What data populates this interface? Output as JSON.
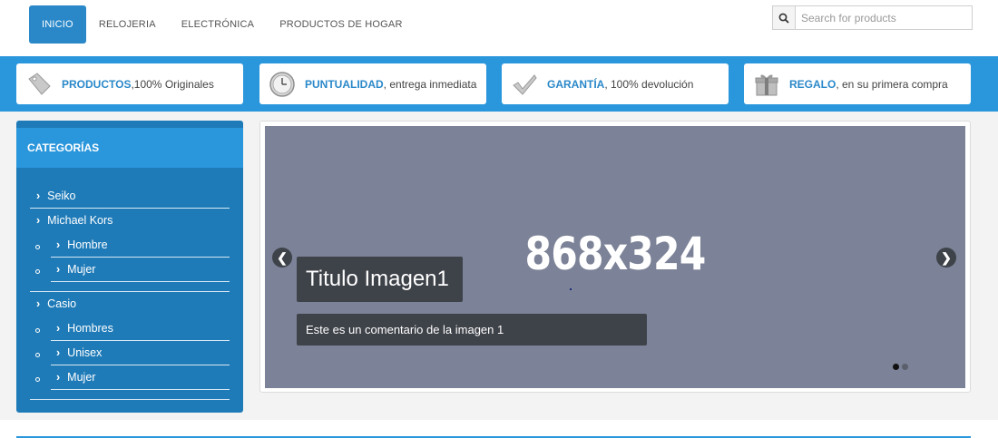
{
  "nav": {
    "items": [
      {
        "label": "INICIO",
        "active": true
      },
      {
        "label": "RELOJERIA",
        "active": false
      },
      {
        "label": "ELECTRÓNICA",
        "active": false
      },
      {
        "label": "PRODUCTOS DE HOGAR",
        "active": false
      }
    ]
  },
  "search": {
    "placeholder": "Search for products",
    "value": ""
  },
  "features": [
    {
      "title": "PRODUCTOS",
      "text": ",100% Originales",
      "icon": "tag-icon"
    },
    {
      "title": "PUNTUALIDAD",
      "text": ", entrega inmediata",
      "icon": "clock-icon"
    },
    {
      "title": "GARANTÍA",
      "text": ", 100% devolución",
      "icon": "checkmark-icon"
    },
    {
      "title": "REGALO",
      "text": ", en su primera compra",
      "icon": "gift-icon"
    }
  ],
  "sidebar": {
    "title": "CATEGORÍAS",
    "items": [
      {
        "label": "Seiko",
        "level": 0
      },
      {
        "label": "Michael Kors",
        "level": 0
      },
      {
        "label": "Hombre",
        "level": 1
      },
      {
        "label": "Mujer",
        "level": 1
      },
      {
        "label": "Casio",
        "level": 0
      },
      {
        "label": "Hombres",
        "level": 1
      },
      {
        "label": "Unisex",
        "level": 1
      },
      {
        "label": "Mujer",
        "level": 1
      }
    ]
  },
  "slider": {
    "placeholder": "868x324",
    "caption_title": "Titulo Imagen1",
    "caption_text": "Este es un comentario de la imagen 1",
    "prev": "❮",
    "next": "❯",
    "indicators": 2,
    "active_index": 0
  },
  "colors": {
    "accent": "#2a96dc",
    "sidebar_bg": "#1f7bb8",
    "slide_bg": "#7c8297",
    "caption_bg": "#3e4249"
  }
}
